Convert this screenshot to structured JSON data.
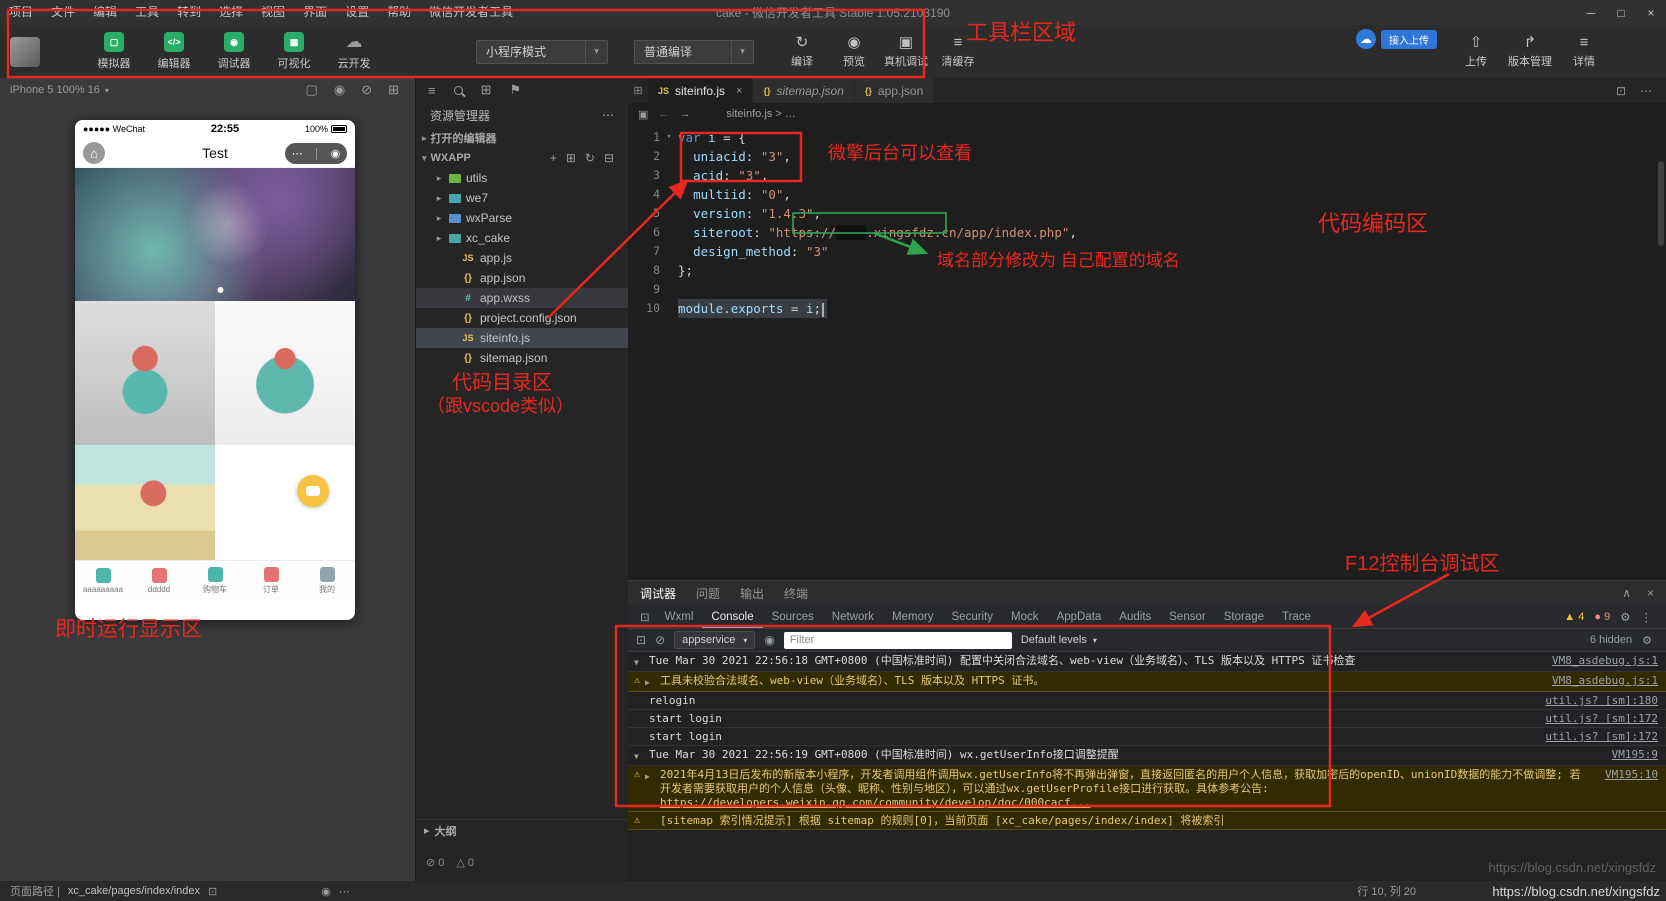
{
  "titlebar": {
    "menu": [
      {
        "label": "项目",
        "name": "menu-project"
      },
      {
        "label": "文件",
        "name": "menu-file"
      },
      {
        "label": "编辑",
        "name": "menu-edit"
      },
      {
        "label": "工具",
        "name": "menu-tools"
      },
      {
        "label": "转到",
        "name": "menu-goto"
      },
      {
        "label": "选择",
        "name": "menu-select"
      },
      {
        "label": "视图",
        "name": "menu-view"
      },
      {
        "label": "界面",
        "name": "menu-ui"
      },
      {
        "label": "设置",
        "name": "menu-settings"
      },
      {
        "label": "帮助",
        "name": "menu-help"
      },
      {
        "label": "微信开发者工具",
        "name": "menu-devtools"
      }
    ],
    "title": "cake - 微信开发者工具 Stable 1.05.2103190",
    "window_controls": [
      {
        "glyph": "─",
        "name": "minimize-button"
      },
      {
        "glyph": "□",
        "name": "maximize-button"
      },
      {
        "glyph": "×",
        "name": "close-button"
      }
    ]
  },
  "toolbar": {
    "toggles": [
      {
        "label": "模拟器",
        "name": "simulator-toggle",
        "icon": "simulator-icon",
        "glyph": "▢",
        "green": true
      },
      {
        "label": "编辑器",
        "name": "editor-toggle",
        "icon": "editor-icon",
        "glyph": "</>",
        "green": true
      },
      {
        "label": "调试器",
        "name": "debugger-toggle",
        "icon": "debugger-icon",
        "glyph": "◉",
        "green": true
      },
      {
        "label": "可视化",
        "name": "visualize-toggle",
        "icon": "visualize-icon",
        "glyph": "▦",
        "green": true
      },
      {
        "label": "云开发",
        "name": "cloud-dev-toggle",
        "icon": "cloud-icon",
        "glyph": "☁",
        "green": false
      }
    ],
    "mode_select": {
      "value": "小程序模式"
    },
    "compile_select": {
      "value": "普通编译"
    },
    "actions": [
      {
        "label": "编译",
        "name": "compile-button",
        "icon": "compile-icon",
        "glyph": "↻"
      },
      {
        "label": "预览",
        "name": "preview-button",
        "icon": "preview-icon",
        "glyph": "◉"
      },
      {
        "label": "真机调试",
        "name": "remote-debug-button",
        "icon": "remote-debug-icon",
        "glyph": "▣"
      },
      {
        "label": "清缓存",
        "name": "clear-cache-button",
        "icon": "clear-cache-icon",
        "glyph": "≡"
      }
    ],
    "upload_badge": {
      "label": "接入上传"
    },
    "right_actions": [
      {
        "label": "上传",
        "name": "upload-button",
        "icon": "upload-icon",
        "glyph": "⇧"
      },
      {
        "label": "版本管理",
        "name": "version-manage-button",
        "icon": "branch-icon",
        "glyph": "↱"
      },
      {
        "label": "详情",
        "name": "details-button",
        "icon": "details-icon",
        "glyph": "≡"
      }
    ]
  },
  "simulator": {
    "device_label": "iPhone 5 100% 16",
    "panel_icons": [
      {
        "name": "rotate-device-icon",
        "glyph": "▢"
      },
      {
        "name": "screenshot-icon",
        "glyph": "◉"
      },
      {
        "name": "mute-icon",
        "glyph": "⊘"
      },
      {
        "name": "multi-window-icon",
        "glyph": "⊞"
      }
    ]
  },
  "phone": {
    "carrier": "●●●●● WeChat",
    "time": "22:55",
    "battery": "100%",
    "nav_title": "Test",
    "capsule": {
      "more": "⋯",
      "record": "◉"
    },
    "tabbar": [
      {
        "label": "aaaaaaaaa",
        "name": "tab-aaaaaaaaa",
        "color": "#4db6ac"
      },
      {
        "label": "ddddd",
        "name": "tab-ddddd",
        "color": "#e57373"
      },
      {
        "label": "购物车",
        "name": "tab-cart",
        "color": "#4db6ac"
      },
      {
        "label": "订单",
        "name": "tab-orders",
        "color": "#e57373"
      },
      {
        "label": "我的",
        "name": "tab-profile",
        "color": "#90a4ae"
      }
    ]
  },
  "explorer": {
    "activity_icons": [
      {
        "name": "explorer-files-icon",
        "glyph": "≡"
      },
      {
        "name": "search-icon",
        "glyph": "@search"
      },
      {
        "name": "extensions-icon",
        "glyph": "⊞"
      },
      {
        "name": "flag-icon",
        "glyph": "⚑"
      }
    ],
    "title": "资源管理器",
    "header_more": "⋯",
    "open_editors": "打开的编辑器",
    "root": "WXAPP",
    "root_icons": [
      {
        "name": "new-file-icon",
        "glyph": "+"
      },
      {
        "name": "new-folder-icon",
        "glyph": "⊞"
      },
      {
        "name": "refresh-icon",
        "glyph": "↻"
      },
      {
        "name": "collapse-all-icon",
        "glyph": "⊟"
      }
    ],
    "tree": [
      {
        "label": "utils",
        "name": "tree-item-utils",
        "kind": "folder",
        "color": "#6cb33f"
      },
      {
        "label": "we7",
        "name": "tree-item-we7",
        "kind": "folder",
        "color": "#46a6b2"
      },
      {
        "label": "wxParse",
        "name": "tree-item-wxparse",
        "kind": "folder",
        "color": "#5a8fd4"
      },
      {
        "label": "xc_cake",
        "name": "tree-item-xc-cake",
        "kind": "folder",
        "color": "#4aa6a0"
      },
      {
        "label": "app.js",
        "name": "tree-item-app-js",
        "kind": "js"
      },
      {
        "label": "app.json",
        "name": "tree-item-app-json",
        "kind": "json"
      },
      {
        "label": "app.wxss",
        "name": "tree-item-app-wxss",
        "kind": "wxss",
        "state": "open"
      },
      {
        "label": "project.config.json",
        "name": "tree-item-project-config-json",
        "kind": "json"
      },
      {
        "label": "siteinfo.js",
        "name": "tree-item-siteinfo-js",
        "kind": "js",
        "state": "selected"
      },
      {
        "label": "sitemap.json",
        "name": "tree-item-sitemap-json",
        "kind": "json"
      }
    ],
    "outline": "大纲",
    "problems": {
      "errors": "0",
      "warnings": "0"
    }
  },
  "editor": {
    "tabs": [
      {
        "label": "siteinfo.js",
        "name": "tab-siteinfo-js",
        "kind": "js",
        "active": true
      },
      {
        "label": "sitemap.json",
        "name": "tab-sitemap-json",
        "kind": "json",
        "preview": true
      },
      {
        "label": "app.json",
        "name": "tab-app-json",
        "kind": "json"
      }
    ],
    "breadcrumb": "siteinfo.js > …",
    "lines": [
      {
        "n": "1",
        "fold": true,
        "tokens": [
          [
            "var",
            "kw"
          ],
          [
            " ",
            "pl"
          ],
          [
            "i",
            "id"
          ],
          [
            " = {",
            "pl"
          ]
        ]
      },
      {
        "n": "2",
        "tokens": [
          [
            "  ",
            "pl"
          ],
          [
            "uniacid",
            "id"
          ],
          [
            ": ",
            "pl"
          ],
          [
            "\"3\"",
            "str"
          ],
          [
            ",",
            "pl"
          ]
        ]
      },
      {
        "n": "3",
        "tokens": [
          [
            "  ",
            "pl"
          ],
          [
            "acid",
            "id"
          ],
          [
            ": ",
            "pl"
          ],
          [
            "\"3\"",
            "str"
          ],
          [
            ",",
            "pl"
          ]
        ]
      },
      {
        "n": "4",
        "tokens": [
          [
            "  ",
            "pl"
          ],
          [
            "multiid",
            "id"
          ],
          [
            ": ",
            "pl"
          ],
          [
            "\"0\"",
            "str"
          ],
          [
            ",",
            "pl"
          ]
        ]
      },
      {
        "n": "5",
        "tokens": [
          [
            "  ",
            "pl"
          ],
          [
            "version",
            "id"
          ],
          [
            ": ",
            "pl"
          ],
          [
            "\"1.4.3\"",
            "str"
          ],
          [
            ",",
            "pl"
          ]
        ]
      },
      {
        "n": "6",
        "tokens": [
          [
            "  ",
            "pl"
          ],
          [
            "siteroot",
            "id"
          ],
          [
            ": ",
            "pl"
          ],
          [
            "\"https://",
            "str"
          ],
          [
            "████",
            "red"
          ],
          [
            ".xingsfdz.cn/app/index.php\"",
            "str"
          ],
          [
            ",",
            "pl"
          ]
        ]
      },
      {
        "n": "7",
        "tokens": [
          [
            "  ",
            "pl"
          ],
          [
            "design_method",
            "id"
          ],
          [
            ": ",
            "pl"
          ],
          [
            "\"3\"",
            "str"
          ]
        ]
      },
      {
        "n": "8",
        "tokens": [
          [
            "};",
            "pl"
          ]
        ]
      },
      {
        "n": "9",
        "tokens": []
      },
      {
        "n": "10",
        "sel": true,
        "tokens": [
          [
            "module",
            "id"
          ],
          [
            ".",
            "pl"
          ],
          [
            "exports",
            "id"
          ],
          [
            " = ",
            "pl"
          ],
          [
            "i",
            "id"
          ],
          [
            ";",
            "pl"
          ]
        ]
      }
    ]
  },
  "debugger": {
    "panel_tabs": [
      {
        "label": "调试器",
        "name": "panel-tab-debugger",
        "active": true
      },
      {
        "label": "问题",
        "name": "panel-tab-problems"
      },
      {
        "label": "输出",
        "name": "panel-tab-output"
      },
      {
        "label": "终端",
        "name": "panel-tab-terminal"
      }
    ],
    "devtools_tabs": [
      {
        "label": "Wxml",
        "name": "devtools-tab-wxml"
      },
      {
        "label": "Console",
        "name": "devtools-tab-console",
        "active": true
      },
      {
        "label": "Sources",
        "name": "devtools-tab-sources"
      },
      {
        "label": "Network",
        "name": "devtools-tab-network"
      },
      {
        "label": "Memory",
        "name": "devtools-tab-memory"
      },
      {
        "label": "Security",
        "name": "devtools-tab-security"
      },
      {
        "label": "Mock",
        "name": "devtools-tab-mock"
      },
      {
        "label": "AppData",
        "name": "devtools-tab-appdata"
      },
      {
        "label": "Audits",
        "name": "devtools-tab-audits"
      },
      {
        "label": "Sensor",
        "name": "devtools-tab-sensor"
      },
      {
        "label": "Storage",
        "name": "devtools-tab-storage"
      },
      {
        "label": "Trace",
        "name": "devtools-tab-trace"
      }
    ]
  },
  "console": {
    "context": "appservice",
    "filter_placeholder": "Filter",
    "levels": "Default levels",
    "hidden": "6 hidden",
    "warn_count": "4",
    "error_count": "9",
    "rows": [
      {
        "level": "log",
        "exp": "▼",
        "text": "Tue Mar 30 2021 22:56:18 GMT+0800 (中国标准时间) 配置中关闭合法域名、web-view（业务域名）、TLS 版本以及 HTTPS 证书检查",
        "src": "VM8_asdebug.js:1"
      },
      {
        "level": "warn",
        "exp": "▶",
        "text": "工具未校验合法域名、web-view（业务域名）、TLS 版本以及 HTTPS 证书。",
        "src": "VM8_asdebug.js:1"
      },
      {
        "level": "log",
        "text": "relogin",
        "src": "util.js? [sm]:180"
      },
      {
        "level": "log",
        "text": "start login",
        "src": "util.js? [sm]:172"
      },
      {
        "level": "log",
        "text": "start login",
        "src": "util.js? [sm]:172"
      },
      {
        "level": "log",
        "exp": "▼",
        "text": "Tue Mar 30 2021 22:56:19 GMT+0800 (中国标准时间) wx.getUserInfo接口调整提醒",
        "src": "VM195:9"
      },
      {
        "level": "warn",
        "exp": "▶",
        "text": "2021年4月13日后发布的新版本小程序，开发者调用组件调用wx.getUserInfo将不再弹出弹窗，直接返回匿名的用户个人信息，获取加密后的openID、unionID数据的能力不做调整; 若开发者需要获取用户的个人信息（头像、昵称、性别与地区），可以通过wx.getUserProfile接口进行获取。具体参考公告: ",
        "link": "https://developers.weixin.qq.com/community/develop/doc/000cacf...",
        "src": "VM195:10"
      },
      {
        "level": "warn",
        "text": "[sitemap 索引情况提示] 根据 sitemap 的规则[0]，当前页面 [xc_cake/pages/index/index] 将被索引",
        "src": ""
      }
    ]
  },
  "statusbar": {
    "path_label": "页面路径 |",
    "path": "xc_cake/pages/index/index",
    "cursor": "行 10, 列 20",
    "watermark": "https://blog.csdn.net/xingsfdz"
  },
  "annotations": {
    "toolbar_area": "工具栏区域",
    "backend_note": "微擎后台可以查看",
    "code_area": "代码编码区",
    "domain_note": "域名部分修改为 自己配置的域名",
    "dir_note_1": "代码目录区",
    "dir_note_2": "（跟vscode类似）",
    "runtime_area": "即时运行显示区",
    "console_area": "F12控制台调试区"
  }
}
